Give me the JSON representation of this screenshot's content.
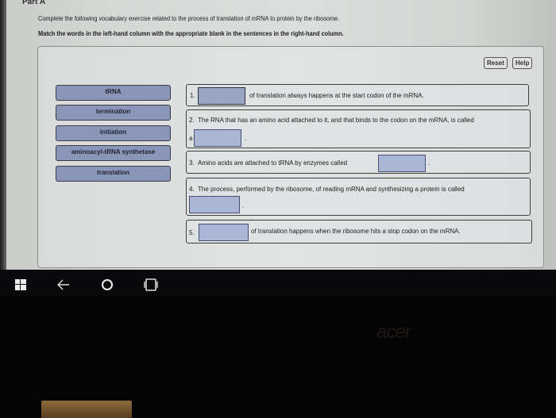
{
  "header": {
    "part_title": "Part A",
    "instruction_1": "Complete the following vocabulary exercise related to the process of translation of mRNA to protein by the ribosome.",
    "instruction_2": "Match the words in the left-hand column with the appropriate blank in the sentences in the right-hand column."
  },
  "toolbar": {
    "reset_label": "Reset",
    "help_label": "Help"
  },
  "word_bank": [
    {
      "label": "tRNA"
    },
    {
      "label": "termination"
    },
    {
      "label": "initiation"
    },
    {
      "label": "aminoacyl-tRNA synthetase"
    },
    {
      "label": "translation"
    }
  ],
  "questions": [
    {
      "number": "1.",
      "before": "",
      "after": "of translation always happens at the start codon of the mRNA.",
      "answer": ""
    },
    {
      "number": "2.",
      "before": "The RNA that has an amino acid attached to it, and that binds to the codon on the mRNA, is called",
      "prefix": "a",
      "after": ".",
      "answer": ""
    },
    {
      "number": "3.",
      "before": "Amino acids are attached to tRNA by enzymes called",
      "after": ".",
      "answer": ""
    },
    {
      "number": "4.",
      "before": "The process, performed by the ribosome, of reading mRNA and synthesizing a protein is called",
      "after": ".",
      "answer": ""
    },
    {
      "number": "5.",
      "before": "",
      "after": "of translation happens when the ribosome hits a stop codon on the mRNA.",
      "answer": ""
    }
  ],
  "taskbar": {
    "icons": [
      "windows-start-icon",
      "back-arrow-icon",
      "search-circle-icon",
      "task-view-icon"
    ]
  },
  "bezel": {
    "brand": "acer"
  }
}
